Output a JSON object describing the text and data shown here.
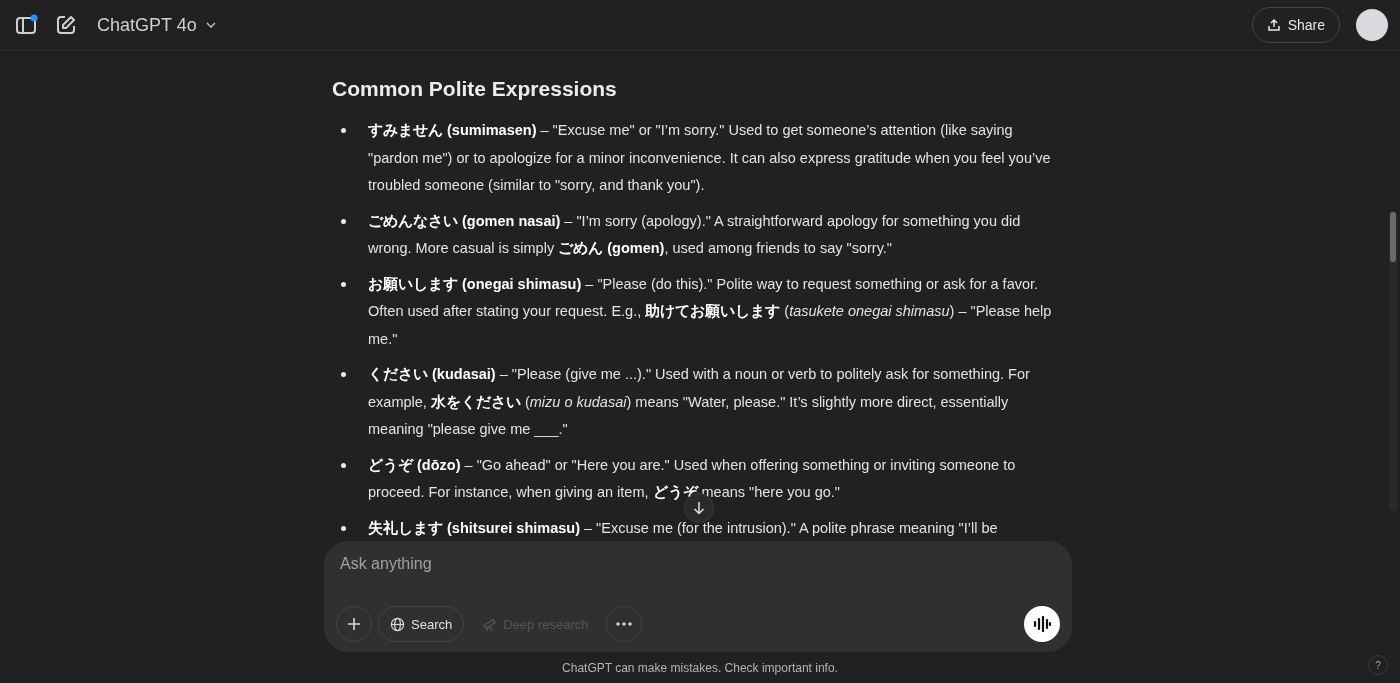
{
  "header": {
    "model": "ChatGPT 4o",
    "share": "Share"
  },
  "article": {
    "heading": "Common Polite Expressions",
    "items": [
      "**すみません (sumimasen)** – \"Excuse me\" or \"I’m sorry.\" Used to get someone’s attention (like saying \"pardon me\") or to apologize for a minor inconvenience. It can also express gratitude when you feel you’ve troubled someone (similar to \"sorry, and thank you\").",
      "**ごめんなさい (gomen nasai)** – \"I’m sorry (apology).\" A straightforward apology for something you did wrong. More casual is simply **ごめん (gomen)**, used among friends to say \"sorry.\"",
      "**お願いします (onegai shimasu)** – \"Please (do this).\" Polite way to request something or ask for a favor. Often used after stating your request. E.g., **助けてお願いします** (*tasukete onegai shimasu*) – \"Please help me.\"",
      "**ください (kudasai)** – \"Please (give me ...).\" Used with a noun or verb to politely ask for something. For example, **水をください** (*mizu o kudasai*) means \"Water, please.\" It’s slightly more direct, essentially meaning \"please give me ___.\"",
      "**どうぞ (dōzo)** – \"Go ahead\" or \"Here you are.\" Used when offering something or inviting someone to proceed. For instance, when giving an item, **どうぞ** means \"here you go.\"",
      "**失礼します (shitsurei shimasu)** – \"Excuse me (for the intrusion).\" A polite phrase meaning \"I’ll be"
    ]
  },
  "composer": {
    "placeholder": "Ask anything",
    "tools": [
      {
        "kind": "plus",
        "disabled": false
      },
      {
        "kind": "search",
        "label": "Search",
        "disabled": false
      },
      {
        "kind": "deep",
        "label": "Deep research",
        "disabled": true
      },
      {
        "kind": "more",
        "disabled": false
      }
    ]
  },
  "footer": "ChatGPT can make mistakes. Check important info.",
  "help": "?"
}
